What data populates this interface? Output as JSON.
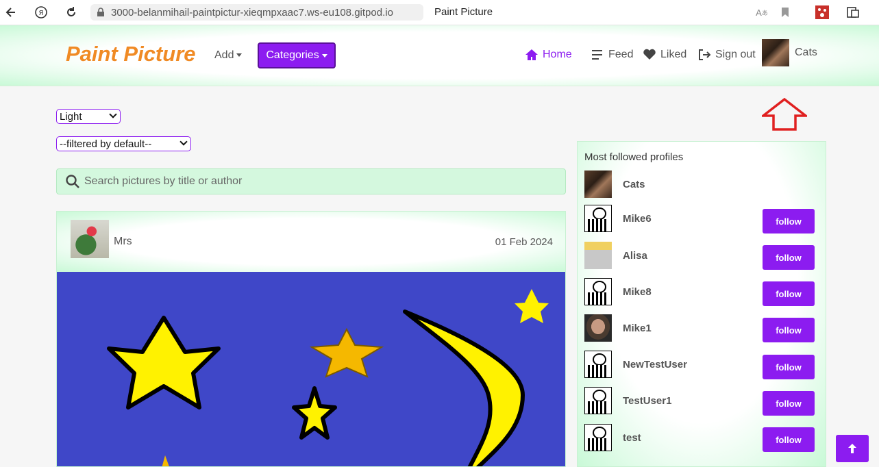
{
  "browser": {
    "url": "3000-belanmihail-paintpictur-xieqmpxaac7.ws-eu108.gitpod.io",
    "tab_title": "Paint Picture"
  },
  "navbar": {
    "brand": "Paint Picture",
    "add_label": "Add",
    "categories_label": "Categories",
    "home_label": "Home",
    "feed_label": "Feed",
    "liked_label": "Liked",
    "signout_label": "Sign out",
    "profile_name": "Cats"
  },
  "controls": {
    "theme_value": "Light",
    "filter_value": "--filtered by default--",
    "search_placeholder": "Search pictures by title or author"
  },
  "post": {
    "author": "Mrs",
    "date": "01 Feb 2024"
  },
  "sidebar": {
    "title": "Most followed profiles",
    "follow_label": "follow",
    "profiles": [
      {
        "name": "Cats",
        "avatar": "cat"
      },
      {
        "name": "Mike6",
        "avatar": "zebra"
      },
      {
        "name": "Alisa",
        "avatar": "alisa"
      },
      {
        "name": "Mike8",
        "avatar": "zebra"
      },
      {
        "name": "Mike1",
        "avatar": "face"
      },
      {
        "name": "NewTestUser",
        "avatar": "zebra"
      },
      {
        "name": "TestUser1",
        "avatar": "zebra"
      },
      {
        "name": "test",
        "avatar": "zebra"
      }
    ]
  },
  "colors": {
    "accent": "#8c1cf0",
    "brand": "#f08a24",
    "mint": "#c9f9d7",
    "painting_bg": "#3f47c8",
    "star": "#fff200",
    "annotation": "#e02020"
  },
  "icons": [
    "back-icon",
    "yandex-icon",
    "reload-icon",
    "lock-icon",
    "translate-icon",
    "bookmark-icon",
    "extension-icon",
    "home-icon",
    "feed-icon",
    "heart-icon",
    "signout-icon",
    "search-icon",
    "arrow-up-icon"
  ]
}
